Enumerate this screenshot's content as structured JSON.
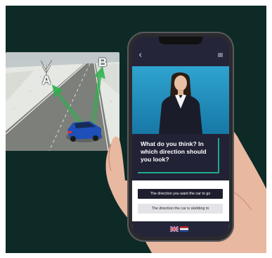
{
  "illustration": {
    "arrow_a_label": "A",
    "arrow_b_label": "B",
    "road_color": "#7d7f7a",
    "snow_color": "#e9ebe6",
    "car_color": "#1f4fb8",
    "arrow_color": "#27b34a"
  },
  "app": {
    "back_icon": "arrow-left-icon",
    "menu_icon": "hamburger-menu-icon",
    "question": "What do you think? In which direction should you look?",
    "answers": [
      "The direction you want the car to go",
      "The direction the car is skidding to"
    ],
    "languages": [
      "English",
      "Dutch"
    ],
    "accent_color": "#1fa987"
  }
}
